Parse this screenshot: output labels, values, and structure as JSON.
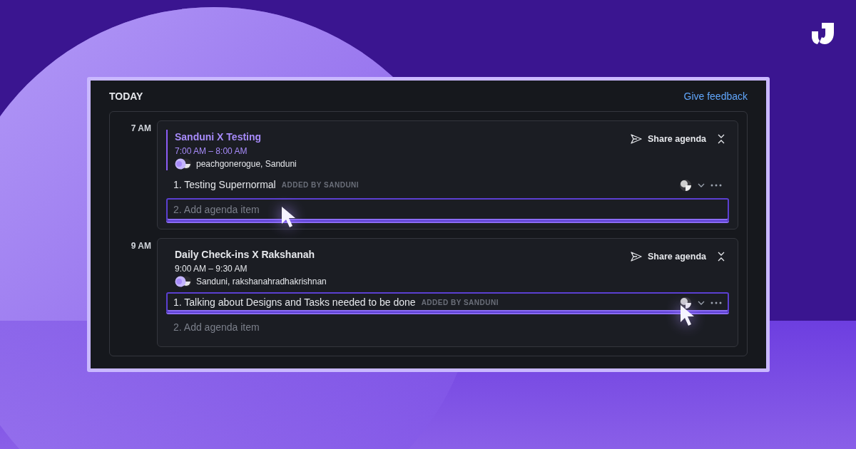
{
  "header": {
    "title": "TODAY",
    "feedback_link": "Give feedback"
  },
  "slots": [
    {
      "time": "7 AM",
      "meeting": {
        "title": "Sanduni X Testing",
        "time_range": "7:00 AM – 8:00 AM",
        "attendees": "peachgonerogue, Sanduni",
        "current": true,
        "share_label": "Share agenda",
        "agenda": [
          {
            "kind": "item",
            "text": "1. Testing Supernormal",
            "added_by": "ADDED BY SANDUNI",
            "focused": false
          },
          {
            "kind": "placeholder",
            "placeholder": "2. Add agenda item",
            "focused": true
          }
        ]
      }
    },
    {
      "time": "9 AM",
      "meeting": {
        "title": "Daily Check-ins X Rakshanah",
        "time_range": "9:00 AM – 9:30 AM",
        "attendees": "Sanduni, rakshanahradhakrishnan",
        "current": false,
        "share_label": "Share agenda",
        "agenda": [
          {
            "kind": "item",
            "text": "1. Talking about Designs and Tasks needed to be done",
            "added_by": "ADDED BY SANDUNI",
            "focused": true
          },
          {
            "kind": "placeholder",
            "placeholder": "2. Add agenda item",
            "focused": false
          }
        ]
      }
    }
  ]
}
